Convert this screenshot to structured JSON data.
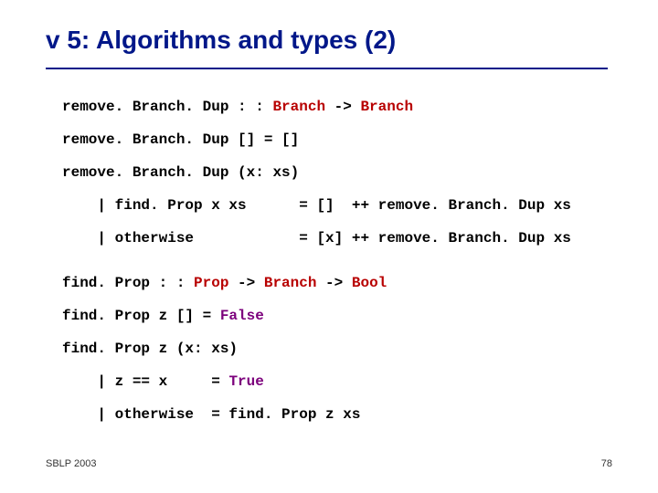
{
  "title": "v 5: Algorithms and types (2)",
  "code": {
    "l1a": "remove. Branch. Dup : : ",
    "l1b": "Branch",
    "l1c": " -> ",
    "l1d": "Branch",
    "l2": "remove. Branch. Dup [] = []",
    "l3": "remove. Branch. Dup (x: xs)",
    "l4": "    | find. Prop x xs      = []  ++ remove. Branch. Dup xs",
    "l5": "    | otherwise            = [x] ++ remove. Branch. Dup xs",
    "l6a": "find. Prop : : ",
    "l6b": "Prop",
    "l6c": " -> ",
    "l6d": "Branch",
    "l6e": " -> ",
    "l6f": "Bool",
    "l7a": "find. Prop z [] = ",
    "l7b": "False",
    "l8": "find. Prop z (x: xs)",
    "l9a": "    | z == x     = ",
    "l9b": "True",
    "l10": "    | otherwise  = find. Prop z xs"
  },
  "footer": {
    "left": "SBLP 2003",
    "right": "78"
  }
}
